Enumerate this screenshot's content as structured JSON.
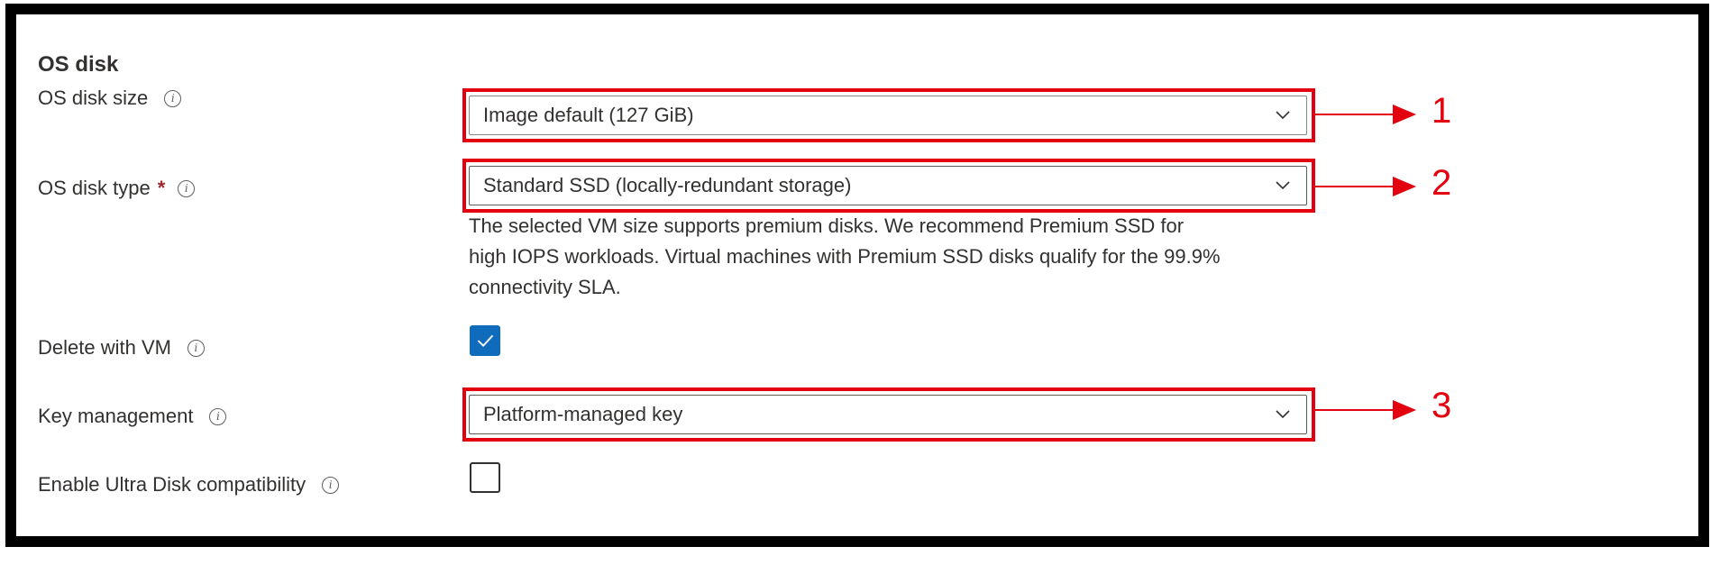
{
  "section": {
    "title": "OS disk"
  },
  "rows": {
    "disk_size": {
      "label": "OS disk size",
      "value": "Image default (127 GiB)"
    },
    "disk_type": {
      "label": "OS disk type",
      "required": "*",
      "value": "Standard SSD (locally-redundant storage)",
      "hint_lines": [
        "The selected VM size supports premium disks. We recommend Premium SSD for",
        "high IOPS workloads. Virtual machines with Premium SSD disks qualify for the 99.9%",
        "connectivity SLA."
      ]
    },
    "delete_with_vm": {
      "label": "Delete with VM",
      "checked": true
    },
    "key_management": {
      "label": "Key management",
      "value": "Platform-managed key"
    },
    "ultra_disk": {
      "label": "Enable Ultra Disk compatibility",
      "checked": false
    }
  },
  "callouts": [
    "1",
    "2",
    "3"
  ],
  "colors": {
    "callout_red": "#e3000f",
    "checkbox_blue": "#0f6cbd",
    "required_red": "#a4262c"
  },
  "icons": {
    "info": "info-icon",
    "chevron": "chevron-down-icon",
    "check": "checkmark-icon"
  }
}
